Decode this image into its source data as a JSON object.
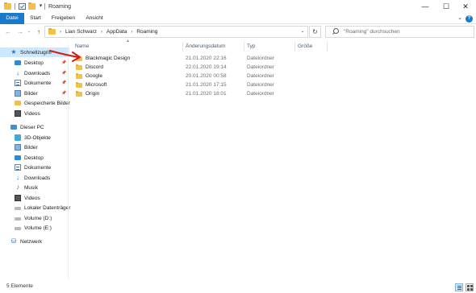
{
  "window": {
    "title": "Roaming",
    "controls": [
      "minimize-icon",
      "maximize-icon",
      "close-icon"
    ]
  },
  "ribbon": {
    "tabs": [
      "Datei",
      "Start",
      "Freigeben",
      "Ansicht"
    ]
  },
  "address": {
    "crumbs": [
      "Lian Schwarz",
      "AppData",
      "Roaming"
    ],
    "search_placeholder": "\"Roaming\" durchsuchen"
  },
  "sidebar": {
    "quick_access": "Schnellzugriff",
    "quick_items": [
      "Desktop",
      "Downloads",
      "Dokumente",
      "Bilder",
      "Gespeicherte Bilder",
      "Videos"
    ],
    "this_pc": "Dieser PC",
    "pc_items": [
      "3D-Objekte",
      "Bilder",
      "Desktop",
      "Dokumente",
      "Downloads",
      "Musik",
      "Videos",
      "Lokaler Datenträger",
      "Volume (D:)",
      "Volume (E:)"
    ],
    "network": "Netzwerk"
  },
  "columns": {
    "name": "Name",
    "date": "Änderungsdatum",
    "type": "Typ",
    "size": "Größe"
  },
  "files": [
    {
      "name": "Blackmagic Design",
      "date": "21.01.2020 22:16",
      "type": "Dateiordner"
    },
    {
      "name": "Discord",
      "date": "22.01.2020 19:14",
      "type": "Dateiordner"
    },
    {
      "name": "Google",
      "date": "20.01.2020 00:58",
      "type": "Dateiordner"
    },
    {
      "name": "Microsoft",
      "date": "21.01.2020 17:15",
      "type": "Dateiordner"
    },
    {
      "name": "Origin",
      "date": "21.01.2020 18:01",
      "type": "Dateiordner"
    }
  ],
  "status": {
    "count": "5 Elemente"
  },
  "colors": {
    "accent": "#1979ca",
    "selection": "#cce8ff",
    "folder": "#f0c24a",
    "annotation_arrow": "#d11a1a"
  }
}
